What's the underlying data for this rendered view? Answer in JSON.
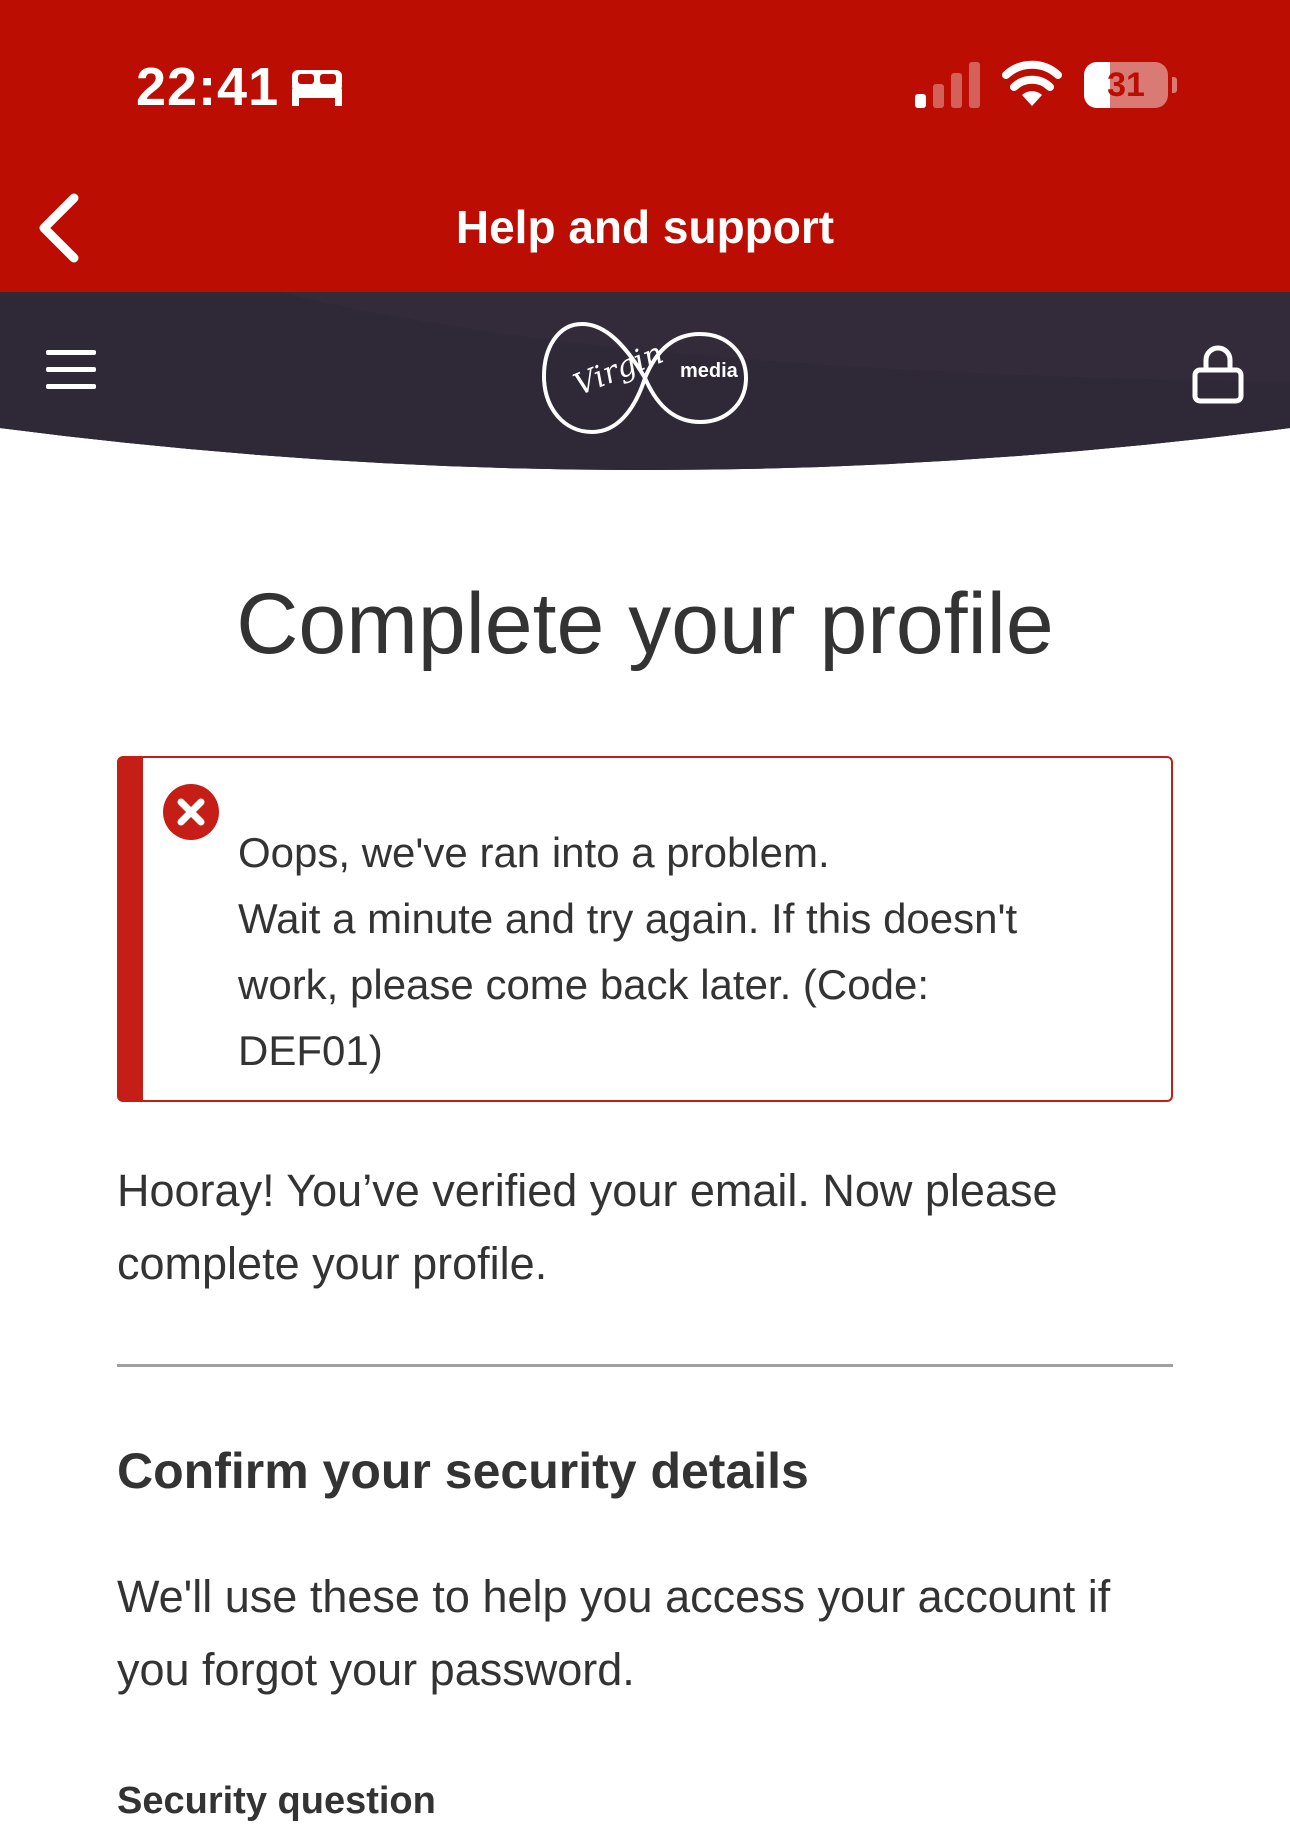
{
  "status_bar": {
    "time": "22:41",
    "battery_level": "31",
    "battery_fraction": 0.31,
    "icons": [
      "sleep-focus-icon",
      "cellular-signal-icon",
      "wifi-icon",
      "battery-icon"
    ]
  },
  "header": {
    "title": "Help and support",
    "back_icon": "chevron-left-icon"
  },
  "site_nav": {
    "menu_icon": "hamburger-menu-icon",
    "logo_virgin": "Virgin",
    "logo_media": "media",
    "account_icon": "lock-icon"
  },
  "page": {
    "title": "Complete your profile"
  },
  "error_alert": {
    "icon": "error-x-icon",
    "lines": [
      "Oops, we've ran into a problem.",
      "Wait a minute and try again. If this doesn't",
      "work, please come back later. (Code:",
      "DEF01)"
    ]
  },
  "intro": {
    "line1": "Hooray! You’ve verified your email. Now please",
    "line2": "complete your profile."
  },
  "security_section": {
    "heading": "Confirm your security details",
    "description_line1": "We'll use these to help you access your account if",
    "description_line2": "you forgot your password.",
    "field_label": "Security question"
  },
  "colors": {
    "header_red": "#bc0d03",
    "nav_dark": "#332b3b",
    "error_red": "#c41e17",
    "text": "#333333"
  }
}
